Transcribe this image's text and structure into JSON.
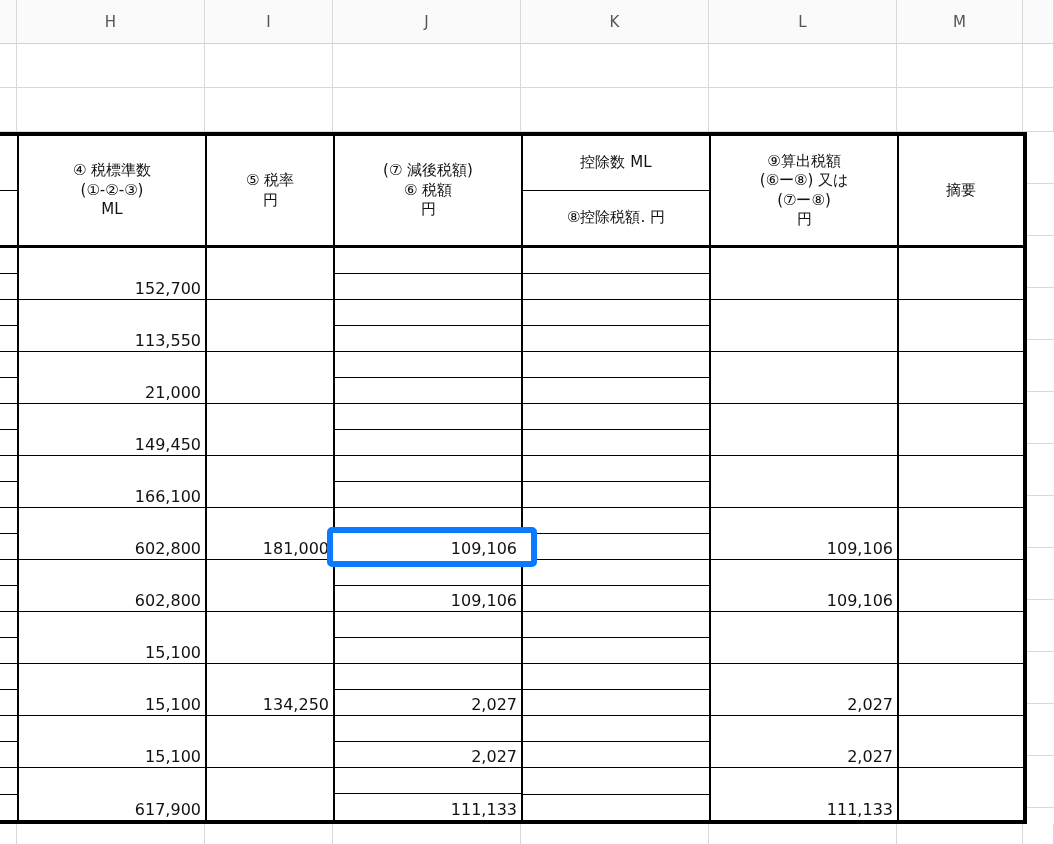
{
  "column_headers": [
    "H",
    "I",
    "J",
    "K",
    "L",
    "M"
  ],
  "table_header": {
    "h": [
      "④ 税標準数",
      "(①-②-③)",
      "ML"
    ],
    "i": [
      "⑤ 税率",
      "円"
    ],
    "j": [
      "(⑦ 減後税額)",
      "⑥ 税額",
      "円"
    ],
    "k_top": [
      "控除数 ML"
    ],
    "k_bottom": [
      "⑧控除税額. 円"
    ],
    "l": [
      "⑨算出税額",
      "(⑥ー⑧) 又は",
      "(⑦ー⑧)",
      "円"
    ],
    "m": [
      "摘要"
    ]
  },
  "rows": [
    {
      "h": "152,700",
      "selected": false
    },
    {
      "h": "113,550",
      "selected": false
    },
    {
      "h": "21,000",
      "selected": false
    },
    {
      "h": "149,450",
      "selected": false
    },
    {
      "h": "166,100",
      "selected": false
    },
    {
      "h": "602,800",
      "i": "181,000",
      "j": "109,106",
      "l": "109,106",
      "selected": true
    },
    {
      "h": "602,800",
      "j": "109,106",
      "l": "109,106",
      "selected": false
    },
    {
      "h": "15,100",
      "selected": false
    },
    {
      "h": "15,100",
      "i": "134,250",
      "j": "2,027",
      "l": "2,027",
      "selected": false
    },
    {
      "h": "15,100",
      "j": "2,027",
      "l": "2,027",
      "selected": false
    },
    {
      "h": "617,900",
      "j": "111,133",
      "l": "111,133",
      "selected": false
    }
  ]
}
